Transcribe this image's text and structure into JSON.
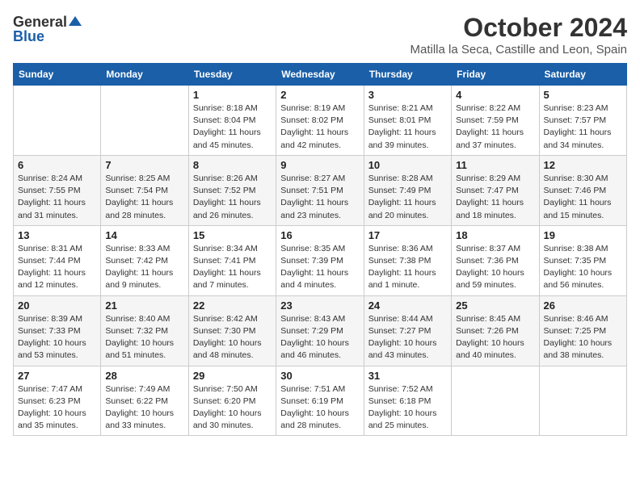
{
  "header": {
    "logo_general": "General",
    "logo_blue": "Blue",
    "month": "October 2024",
    "location": "Matilla la Seca, Castille and Leon, Spain"
  },
  "days_of_week": [
    "Sunday",
    "Monday",
    "Tuesday",
    "Wednesday",
    "Thursday",
    "Friday",
    "Saturday"
  ],
  "weeks": [
    [
      {
        "day": "",
        "info": ""
      },
      {
        "day": "",
        "info": ""
      },
      {
        "day": "1",
        "info": "Sunrise: 8:18 AM\nSunset: 8:04 PM\nDaylight: 11 hours\nand 45 minutes."
      },
      {
        "day": "2",
        "info": "Sunrise: 8:19 AM\nSunset: 8:02 PM\nDaylight: 11 hours\nand 42 minutes."
      },
      {
        "day": "3",
        "info": "Sunrise: 8:21 AM\nSunset: 8:01 PM\nDaylight: 11 hours\nand 39 minutes."
      },
      {
        "day": "4",
        "info": "Sunrise: 8:22 AM\nSunset: 7:59 PM\nDaylight: 11 hours\nand 37 minutes."
      },
      {
        "day": "5",
        "info": "Sunrise: 8:23 AM\nSunset: 7:57 PM\nDaylight: 11 hours\nand 34 minutes."
      }
    ],
    [
      {
        "day": "6",
        "info": "Sunrise: 8:24 AM\nSunset: 7:55 PM\nDaylight: 11 hours\nand 31 minutes."
      },
      {
        "day": "7",
        "info": "Sunrise: 8:25 AM\nSunset: 7:54 PM\nDaylight: 11 hours\nand 28 minutes."
      },
      {
        "day": "8",
        "info": "Sunrise: 8:26 AM\nSunset: 7:52 PM\nDaylight: 11 hours\nand 26 minutes."
      },
      {
        "day": "9",
        "info": "Sunrise: 8:27 AM\nSunset: 7:51 PM\nDaylight: 11 hours\nand 23 minutes."
      },
      {
        "day": "10",
        "info": "Sunrise: 8:28 AM\nSunset: 7:49 PM\nDaylight: 11 hours\nand 20 minutes."
      },
      {
        "day": "11",
        "info": "Sunrise: 8:29 AM\nSunset: 7:47 PM\nDaylight: 11 hours\nand 18 minutes."
      },
      {
        "day": "12",
        "info": "Sunrise: 8:30 AM\nSunset: 7:46 PM\nDaylight: 11 hours\nand 15 minutes."
      }
    ],
    [
      {
        "day": "13",
        "info": "Sunrise: 8:31 AM\nSunset: 7:44 PM\nDaylight: 11 hours\nand 12 minutes."
      },
      {
        "day": "14",
        "info": "Sunrise: 8:33 AM\nSunset: 7:42 PM\nDaylight: 11 hours\nand 9 minutes."
      },
      {
        "day": "15",
        "info": "Sunrise: 8:34 AM\nSunset: 7:41 PM\nDaylight: 11 hours\nand 7 minutes."
      },
      {
        "day": "16",
        "info": "Sunrise: 8:35 AM\nSunset: 7:39 PM\nDaylight: 11 hours\nand 4 minutes."
      },
      {
        "day": "17",
        "info": "Sunrise: 8:36 AM\nSunset: 7:38 PM\nDaylight: 11 hours\nand 1 minute."
      },
      {
        "day": "18",
        "info": "Sunrise: 8:37 AM\nSunset: 7:36 PM\nDaylight: 10 hours\nand 59 minutes."
      },
      {
        "day": "19",
        "info": "Sunrise: 8:38 AM\nSunset: 7:35 PM\nDaylight: 10 hours\nand 56 minutes."
      }
    ],
    [
      {
        "day": "20",
        "info": "Sunrise: 8:39 AM\nSunset: 7:33 PM\nDaylight: 10 hours\nand 53 minutes."
      },
      {
        "day": "21",
        "info": "Sunrise: 8:40 AM\nSunset: 7:32 PM\nDaylight: 10 hours\nand 51 minutes."
      },
      {
        "day": "22",
        "info": "Sunrise: 8:42 AM\nSunset: 7:30 PM\nDaylight: 10 hours\nand 48 minutes."
      },
      {
        "day": "23",
        "info": "Sunrise: 8:43 AM\nSunset: 7:29 PM\nDaylight: 10 hours\nand 46 minutes."
      },
      {
        "day": "24",
        "info": "Sunrise: 8:44 AM\nSunset: 7:27 PM\nDaylight: 10 hours\nand 43 minutes."
      },
      {
        "day": "25",
        "info": "Sunrise: 8:45 AM\nSunset: 7:26 PM\nDaylight: 10 hours\nand 40 minutes."
      },
      {
        "day": "26",
        "info": "Sunrise: 8:46 AM\nSunset: 7:25 PM\nDaylight: 10 hours\nand 38 minutes."
      }
    ],
    [
      {
        "day": "27",
        "info": "Sunrise: 7:47 AM\nSunset: 6:23 PM\nDaylight: 10 hours\nand 35 minutes."
      },
      {
        "day": "28",
        "info": "Sunrise: 7:49 AM\nSunset: 6:22 PM\nDaylight: 10 hours\nand 33 minutes."
      },
      {
        "day": "29",
        "info": "Sunrise: 7:50 AM\nSunset: 6:20 PM\nDaylight: 10 hours\nand 30 minutes."
      },
      {
        "day": "30",
        "info": "Sunrise: 7:51 AM\nSunset: 6:19 PM\nDaylight: 10 hours\nand 28 minutes."
      },
      {
        "day": "31",
        "info": "Sunrise: 7:52 AM\nSunset: 6:18 PM\nDaylight: 10 hours\nand 25 minutes."
      },
      {
        "day": "",
        "info": ""
      },
      {
        "day": "",
        "info": ""
      }
    ]
  ]
}
